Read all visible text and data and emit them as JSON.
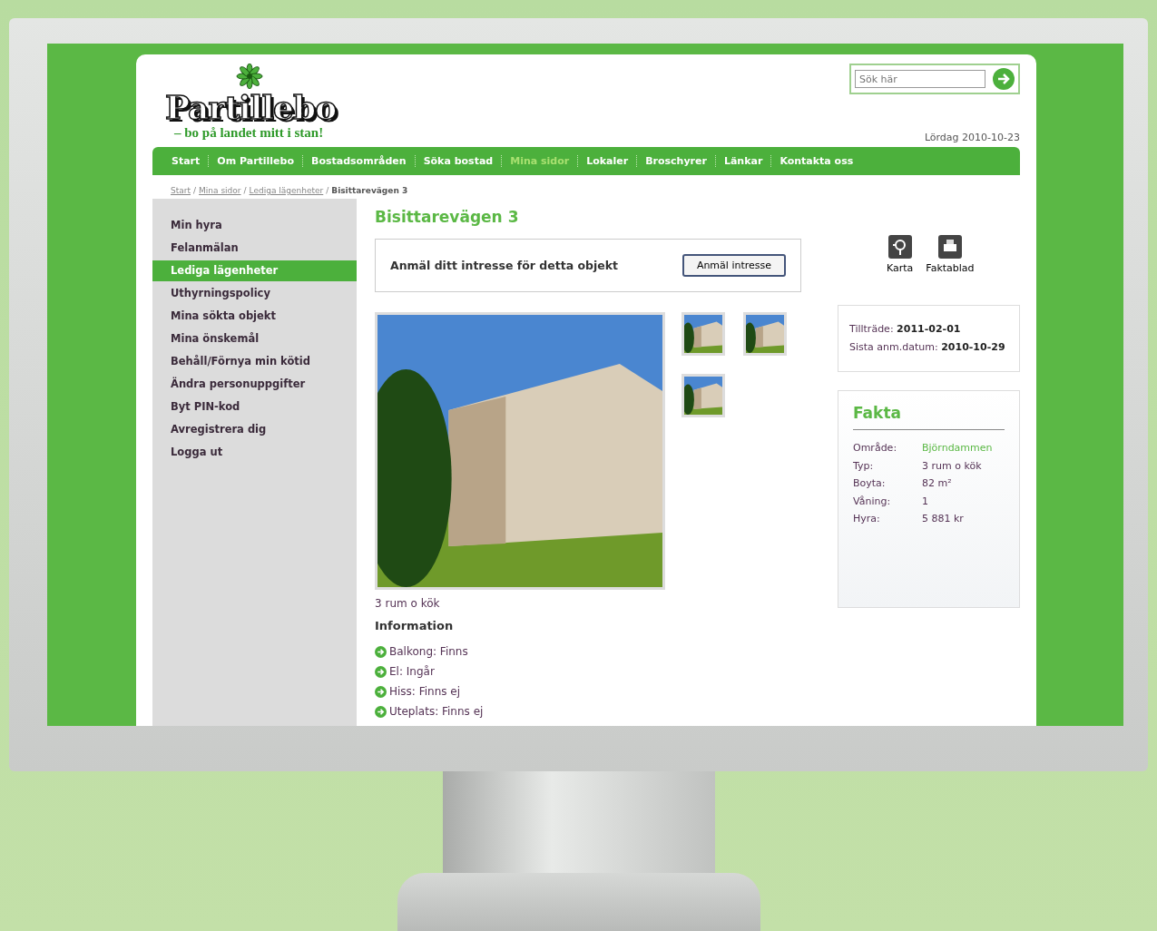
{
  "header": {
    "logo": "Partillebo",
    "slogan": "– bo på landet mitt i stan!",
    "search": {
      "placeholder": "Sök här"
    },
    "date": "Lördag 2010-10-23"
  },
  "nav": [
    {
      "label": "Start",
      "selected": false
    },
    {
      "label": "Om Partillebo",
      "selected": false
    },
    {
      "label": "Bostadsområden",
      "selected": false
    },
    {
      "label": "Söka bostad",
      "selected": false
    },
    {
      "label": "Mina sidor",
      "selected": true
    },
    {
      "label": "Lokaler",
      "selected": false
    },
    {
      "label": "Broschyrer",
      "selected": false
    },
    {
      "label": "Länkar",
      "selected": false
    },
    {
      "label": "Kontakta oss",
      "selected": false
    }
  ],
  "breadcrumb_separator": "/",
  "breadcrumbs": [
    {
      "label": "Start",
      "kind": "link"
    },
    {
      "label": "Mina sidor",
      "kind": "link"
    },
    {
      "label": "Lediga lägenheter",
      "kind": "link"
    },
    {
      "label": "Bisittarevägen 3",
      "kind": "current"
    }
  ],
  "sidebar": {
    "items": [
      {
        "label": "Min hyra",
        "selected": false
      },
      {
        "label": "Felanmälan",
        "selected": false
      },
      {
        "label": "Lediga lägenheter",
        "selected": true
      },
      {
        "label": "Uthyrningspolicy",
        "selected": false
      },
      {
        "label": "Mina sökta objekt",
        "selected": false
      },
      {
        "label": "Mina önskemål",
        "selected": false
      },
      {
        "label": "Behåll/Förnya min kötid",
        "selected": false
      },
      {
        "label": "Ändra personuppgifter",
        "selected": false
      },
      {
        "label": "Byt PIN-kod",
        "selected": false
      },
      {
        "label": "Avregistrera dig",
        "selected": false
      },
      {
        "label": "Logga ut",
        "selected": false
      }
    ]
  },
  "title": "Bisittarevägen 3",
  "interest": {
    "text": "Anmäl ditt intresse för detta objekt",
    "button": "Anmäl intresse"
  },
  "caption": "3 rum o kök",
  "information": {
    "heading": "Information",
    "items": [
      "Balkong: Finns",
      "El: Ingår",
      "Hiss: Finns ej",
      "Uteplats: Finns ej"
    ]
  },
  "tools": [
    {
      "label": "Karta",
      "kind": "map"
    },
    {
      "label": "Faktablad",
      "kind": "print"
    }
  ],
  "dates": [
    {
      "label": "Tillträde:",
      "value": "2011-02-01"
    },
    {
      "label": "Sista anm.datum:",
      "value": "2010-10-29"
    }
  ],
  "facts": {
    "heading": "Fakta",
    "rows": [
      {
        "label": "Område:",
        "value": "Björndammen",
        "kind": "link"
      },
      {
        "label": "Typ:",
        "value": "3 rum o kök",
        "kind": "text"
      },
      {
        "label": "Boyta:",
        "value": "82 m²",
        "kind": "text"
      },
      {
        "label": "Våning:",
        "value": "1",
        "kind": "text"
      },
      {
        "label": "Hyra:",
        "value": "5 881 kr",
        "kind": "text"
      }
    ]
  }
}
